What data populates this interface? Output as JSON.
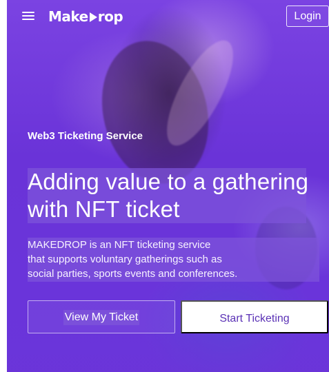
{
  "header": {
    "menu_icon": "hamburger-menu-icon",
    "logo_text_left": "Make",
    "logo_text_right": "rop",
    "logo_mark": "play-triangle-icon",
    "login_label": "Login"
  },
  "hero": {
    "eyebrow": "Web3 Ticketing Service",
    "headline": [
      "Adding value to a gathering",
      "with NFT ticket"
    ],
    "description": [
      "MAKEDROP is an NFT ticketing service",
      "that supports voluntary gatherings such as",
      "social parties, sports events and conferences."
    ],
    "actions": {
      "view_ticket_label": "View My Ticket",
      "start_ticketing_label": "Start Ticketing"
    }
  },
  "colors": {
    "brand_purple": "#6c34d6",
    "text_white": "#ffffff",
    "button_text_purple": "#5a31b5"
  }
}
